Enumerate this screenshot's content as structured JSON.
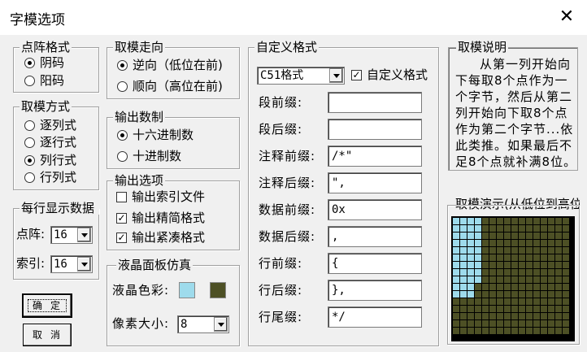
{
  "window": {
    "title": "字模选项",
    "close_glyph": "✕"
  },
  "dot_format": {
    "label": "点阵格式",
    "options": [
      {
        "label": "阴码",
        "selected": true
      },
      {
        "label": "阳码",
        "selected": false
      }
    ]
  },
  "scan_mode": {
    "label": "取模方式",
    "options": [
      {
        "label": "逐列式",
        "selected": false
      },
      {
        "label": "逐行式",
        "selected": false
      },
      {
        "label": "列行式",
        "selected": true
      },
      {
        "label": "行列式",
        "selected": false
      }
    ]
  },
  "per_line": {
    "label": "每行显示数据",
    "dot_label": "点阵:",
    "dot_value": "16",
    "index_label": "索引:",
    "index_value": "16"
  },
  "buttons": {
    "ok": "确定",
    "cancel": "取消"
  },
  "direction": {
    "label": "取模走向",
    "options": [
      {
        "label": "逆向（低位在前)",
        "selected": true
      },
      {
        "label": "顺向（高位在前)",
        "selected": false
      }
    ]
  },
  "number_base": {
    "label": "输出数制",
    "options": [
      {
        "label": "十六进制数",
        "selected": true
      },
      {
        "label": "十进制数",
        "selected": false
      }
    ]
  },
  "output_options": {
    "label": "输出选项",
    "options": [
      {
        "label": "输出索引文件",
        "checked": false
      },
      {
        "label": "输出精简格式",
        "checked": true
      },
      {
        "label": "输出紧凑格式",
        "checked": true
      }
    ]
  },
  "lcd": {
    "label": "液晶面板仿真",
    "color_label": "液晶色彩:",
    "color_on": "#9edbec",
    "color_off": "#4d5025",
    "pixel_label": "像素大小:",
    "pixel_value": "8"
  },
  "custom": {
    "label": "自定义格式",
    "format_value": "C51格式",
    "custom_check_label": "自定义格式",
    "custom_checked": true,
    "fields": [
      {
        "label": "段前缀:",
        "value": ""
      },
      {
        "label": "段后缀:",
        "value": ""
      },
      {
        "label": "注释前缀:",
        "value": "/*\""
      },
      {
        "label": "注释后缀:",
        "value": "\","
      },
      {
        "label": "数据前缀:",
        "value": "0x"
      },
      {
        "label": "数据后缀:",
        "value": ","
      },
      {
        "label": "行前缀:",
        "value": "{"
      },
      {
        "label": "行后缀:",
        "value": "},"
      },
      {
        "label": "行尾缀:",
        "value": "*/"
      }
    ]
  },
  "description": {
    "label": "取模说明",
    "text": "从第一列开始向下每取8个点作为一个字节，然后从第二列开始向下取8个点作为第二个字节...依此类推。如果最后不足8个点就补满8位。取模顺序是从低到高"
  },
  "demo": {
    "label": "取模演示(从低位到高位)",
    "grid_cols": 16,
    "grid_rows": 16,
    "lit_cells": [
      [
        0,
        0
      ],
      [
        1,
        0
      ],
      [
        2,
        0
      ],
      [
        3,
        0
      ],
      [
        0,
        1
      ],
      [
        1,
        1
      ],
      [
        2,
        1
      ],
      [
        3,
        1
      ],
      [
        0,
        2
      ],
      [
        1,
        2
      ],
      [
        2,
        2
      ],
      [
        3,
        2
      ],
      [
        0,
        3
      ],
      [
        1,
        3
      ],
      [
        2,
        3
      ],
      [
        3,
        3
      ],
      [
        0,
        4
      ],
      [
        1,
        4
      ],
      [
        2,
        4
      ],
      [
        3,
        4
      ],
      [
        0,
        5
      ],
      [
        1,
        5
      ],
      [
        2,
        5
      ],
      [
        3,
        5
      ],
      [
        0,
        6
      ],
      [
        1,
        6
      ],
      [
        2,
        6
      ],
      [
        3,
        6
      ],
      [
        0,
        7
      ],
      [
        1,
        7
      ],
      [
        2,
        7
      ],
      [
        3,
        7
      ],
      [
        0,
        8
      ],
      [
        1,
        8
      ],
      [
        2,
        8
      ],
      [
        3,
        8
      ],
      [
        0,
        9
      ],
      [
        1,
        9
      ],
      [
        2,
        9
      ],
      [
        0,
        10
      ],
      [
        1,
        10
      ],
      [
        2,
        10
      ]
    ]
  }
}
